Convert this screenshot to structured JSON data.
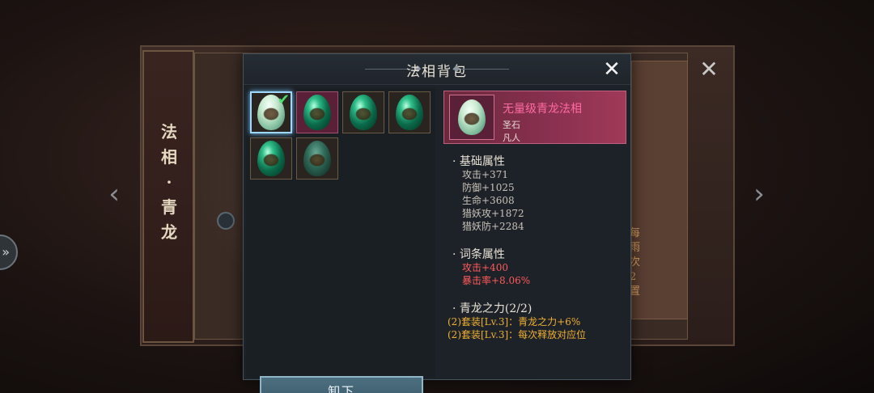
{
  "background": {
    "scroll_title": [
      "法",
      "相",
      "·",
      "青",
      "龙"
    ],
    "side_text": [
      "每",
      "雨",
      "次2",
      "置"
    ]
  },
  "dialog": {
    "title": "法相背包",
    "unequip_label": "卸下"
  },
  "bag": {
    "slots": [
      {
        "variant": "light",
        "selected": true,
        "equipped": true
      },
      {
        "variant": "green",
        "selected": false,
        "equipped": false
      },
      {
        "variant": "green",
        "selected": false,
        "equipped": false
      },
      {
        "variant": "green",
        "selected": false,
        "equipped": false
      },
      {
        "variant": "green",
        "selected": false,
        "equipped": false
      },
      {
        "variant": "dark",
        "selected": false,
        "equipped": false
      }
    ]
  },
  "item": {
    "name": "无量级青龙法相",
    "type": "圣石",
    "rank": "凡人"
  },
  "base_attr": {
    "title": "· 基础属性",
    "stats": [
      "攻击+371",
      "防御+1025",
      "生命+3608",
      "猎妖攻+1872",
      "猎妖防+2284"
    ]
  },
  "affix_attr": {
    "title": "· 词条属性",
    "stats": [
      "攻击+400",
      "暴击率+8.06%"
    ]
  },
  "set_attr": {
    "title": "· 青龙之力(2/2)",
    "lines": [
      "(2)套装[Lv.3]：青龙之力+6%",
      "(2)套装[Lv.3]：每次释放对应位"
    ]
  },
  "colors": {
    "item_name": "#ff6aa0",
    "affix": "#ff5a5a",
    "set_bonus": "#f0b030",
    "button": "#4d7080"
  }
}
